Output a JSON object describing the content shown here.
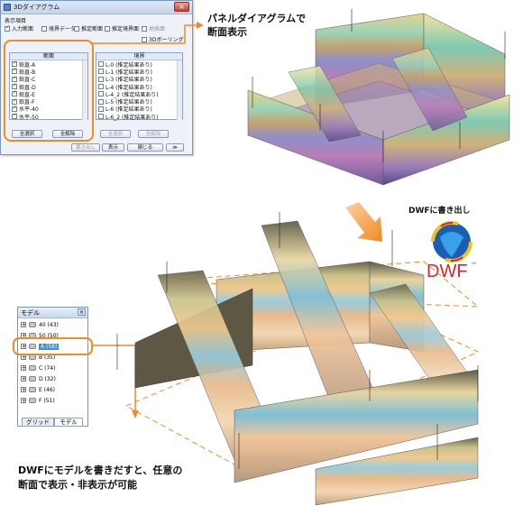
{
  "dialog": {
    "title": "3Dダイアグラム",
    "display_items_label": "表示項目",
    "checkboxes": [
      {
        "label": "入力断面",
        "checked": true
      },
      {
        "label": "境界データ",
        "checked": false
      },
      {
        "label": "推定断面",
        "checked": false
      },
      {
        "label": "推定境界面",
        "checked": false
      }
    ],
    "right_checks": [
      {
        "label": "地表面",
        "checked": false
      },
      {
        "label": "3Dボーリング",
        "checked": false
      }
    ],
    "left_list": {
      "header": "断面",
      "items": [
        {
          "label": "鉛直-A",
          "checked": true
        },
        {
          "label": "鉛直-B",
          "checked": true
        },
        {
          "label": "鉛直-C",
          "checked": true
        },
        {
          "label": "鉛直-D",
          "checked": true
        },
        {
          "label": "鉛直-E",
          "checked": true
        },
        {
          "label": "鉛直-F",
          "checked": true
        },
        {
          "label": "水平-40",
          "checked": true
        },
        {
          "label": "水平-50",
          "checked": true
        }
      ],
      "select_all": "全選択",
      "clear_all": "全解除"
    },
    "right_list": {
      "header": "境界",
      "items": [
        {
          "label": "L-0 (推定結果あり)",
          "checked": false
        },
        {
          "label": "L-1 (推定結果あり)",
          "checked": false
        },
        {
          "label": "L-3 (推定結果あり)",
          "checked": false
        },
        {
          "label": "L-4 (推定結果あり)",
          "checked": false
        },
        {
          "label": "L-4_2 (推定結果あり)",
          "checked": false
        },
        {
          "label": "L-5 (推定結果あり)",
          "checked": false
        },
        {
          "label": "L-6 (推定結果あり)",
          "checked": false
        },
        {
          "label": "L-6_2 (推定結果あり)",
          "checked": false
        }
      ],
      "select_all": "全選択",
      "clear_all": "全解除"
    },
    "footer_buttons": {
      "export": "書き出し",
      "show": "表示",
      "close": "閉じる",
      "more": "≫"
    }
  },
  "model_panel": {
    "title": "モデル",
    "items": [
      {
        "label": "40 (43)"
      },
      {
        "label": "50 (50)"
      },
      {
        "label": "A (58)",
        "selected": true
      },
      {
        "label": "B (35)"
      },
      {
        "label": "C (74)"
      },
      {
        "label": "D (32)"
      },
      {
        "label": "E (46)"
      },
      {
        "label": "F (51)"
      }
    ],
    "tabs": [
      "グリッド",
      "モデル"
    ]
  },
  "captions": {
    "top_line1": "パネルダイアグラムで",
    "top_line2": "断面表示",
    "dwf_export": "DWFに書き出し",
    "dwf_logo": "DWF",
    "dwf_tm": "™",
    "bottom_line1": "DWFにモデルを書きだすと、任意の",
    "bottom_line2": "断面で表示・非表示が可能"
  },
  "colors": {
    "accent_orange": "#f08a24",
    "dialog_bg": "#eef2f8",
    "selection_blue": "#3d8ee8",
    "dwf_red": "#d8262f"
  },
  "icons": [
    "app-icon",
    "close-icon",
    "expand-plus-icon",
    "model-icon",
    "arrow-right-icon",
    "arrow-down-icon",
    "dwf-globe-icon"
  ]
}
